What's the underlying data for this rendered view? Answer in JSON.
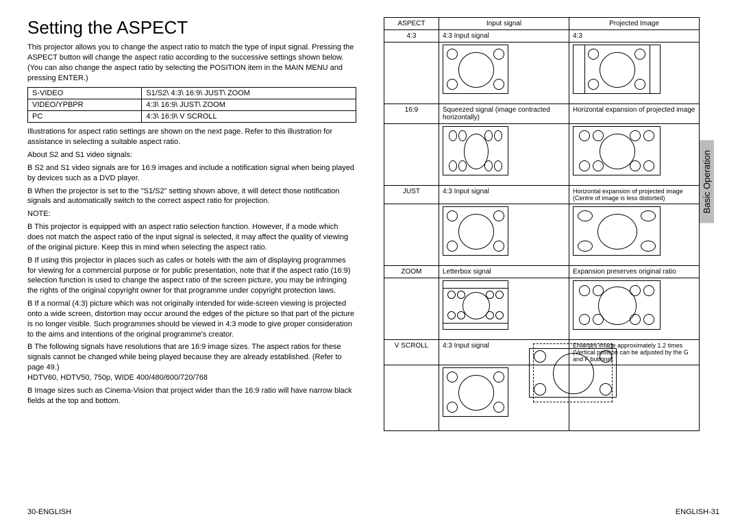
{
  "title": "Setting the ASPECT",
  "intro": "This projector allows you to change the aspect ratio to match the type of input signal. Pressing the ASPECT button will change the aspect ratio according to the successive settings shown below.\n(You can also change the aspect ratio by selecting the POSITION item in the MAIN MENU and pressing ENTER.)",
  "modes": {
    "rows": [
      {
        "label": "S-VIDEO",
        "value": "S1/S2\\  4:3\\  16:9\\  JUST\\  ZOOM"
      },
      {
        "label": "VIDEO/YPBPR",
        "value": "4:3\\  16:9\\  JUST\\  ZOOM"
      },
      {
        "label": "PC",
        "value": "4:3\\  16:9\\  V SCROLL"
      }
    ]
  },
  "illus_note": "Illustrations for aspect ratio settings are shown on the next page. Refer to this illustration for assistance in selecting a suitable aspect ratio.",
  "about_heading": "About S2 and S1 video signals:",
  "about_bullets": [
    "S2 and S1 video signals are for 16:9 images and include a notification signal when being played by devices such as a DVD player.",
    "When the projector is set to the \"S1/S2\" setting shown above, it will detect those notification signals and automatically switch to the correct aspect ratio for projection."
  ],
  "note_heading": "NOTE:",
  "note_bullets": [
    "This projector is equipped with an aspect ratio selection function. However, if a mode which does not match the aspect ratio of the input signal is selected, it may affect the quality of viewing of the original picture. Keep this in mind when selecting the aspect ratio.",
    "If using this projector in places such as cafes or hotels with the aim of displaying programmes for viewing for a commercial purpose or for public presentation, note that if the aspect ratio (16:9) selection function is used to change the aspect ratio of the screen picture, you may be infringing the rights of the original copyright owner for that programme under copyright protection laws.",
    "If a normal (4:3) picture which was not originally intended for wide-screen viewing is projected onto a wide screen, distortion may occur around the edges of the picture so that part of the picture is no longer visible. Such programmes should be viewed in 4:3 mode to give proper consideration to the aims and intentions of the original programme's creator.",
    "The following signals have resolutions that are 16:9 image sizes. The aspect ratios for these signals cannot be changed while being played because they are already established. (Refer to page 49.)\nHDTV60, HDTV50, 750p, WIDE 400/480/600/720/768",
    "Image sizes such as Cinema-Vision that project wider than the 16:9 ratio will have narrow black fields at the top and bottom."
  ],
  "table": {
    "headers": [
      "ASPECT",
      "Input signal",
      "Projected Image"
    ],
    "rows": [
      {
        "aspect": "4:3",
        "input": "4:3 Input signal",
        "output": "4:3"
      },
      {
        "aspect": "16:9",
        "input": "Squeezed signal (image contracted horizontally)",
        "output": "Horizontal expansion of projected image"
      },
      {
        "aspect": "JUST",
        "input": "4:3 Input signal",
        "output": "Horizontal expansion of projected image (Centre of image is less distorted)"
      },
      {
        "aspect": "ZOOM",
        "input": "Letterbox signal",
        "output": "Expansion preserves original ratio"
      },
      {
        "aspect": "V SCROLL",
        "input": "4:3 Input signal",
        "output": "Enlarges image approximately 1.2 times (Vertical position can be adjusted by the G and F buttons)"
      }
    ]
  },
  "side_tab": "Basic Operation",
  "footer_left_page": "30-",
  "footer_left_lang": "ENGLISH",
  "footer_right_lang": "ENGLISH",
  "footer_right_page": "-31"
}
